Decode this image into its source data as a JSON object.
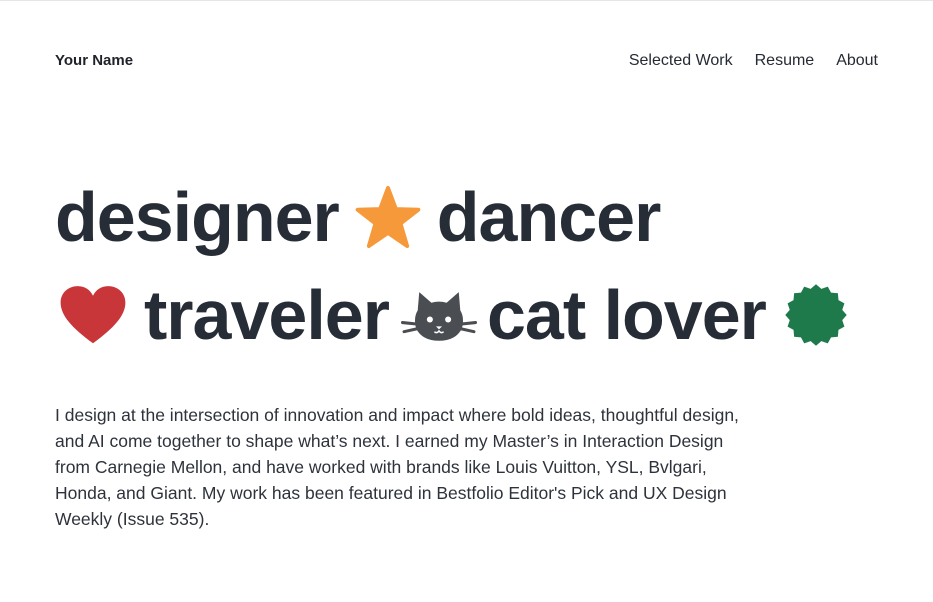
{
  "header": {
    "brand": "Your Name",
    "nav": [
      {
        "label": "Selected Work"
      },
      {
        "label": "Resume"
      },
      {
        "label": "About"
      }
    ]
  },
  "hero": {
    "line1": {
      "word1": "designer",
      "icon1": "star-icon",
      "word2": "dancer"
    },
    "line2": {
      "icon1": "heart-icon",
      "word1": "traveler",
      "icon2": "cat-icon",
      "word2": "cat lover",
      "icon3": "badge-icon"
    }
  },
  "bio": {
    "text": "I design at the intersection of innovation and impact where bold ideas, thoughtful design, and AI come together to shape what’s next. I earned my Master’s in Interaction Design from Carnegie Mellon, and have worked with brands like Louis Vuitton, YSL, Bvlgari, Honda, and Giant. My work has been featured in Bestfolio Editor's Pick and UX Design Weekly (Issue 535)."
  },
  "colors": {
    "star": "#f5993a",
    "heart": "#c9363a",
    "cat": "#4a4d52",
    "badge": "#1e7a4a",
    "text": "#272d36"
  }
}
